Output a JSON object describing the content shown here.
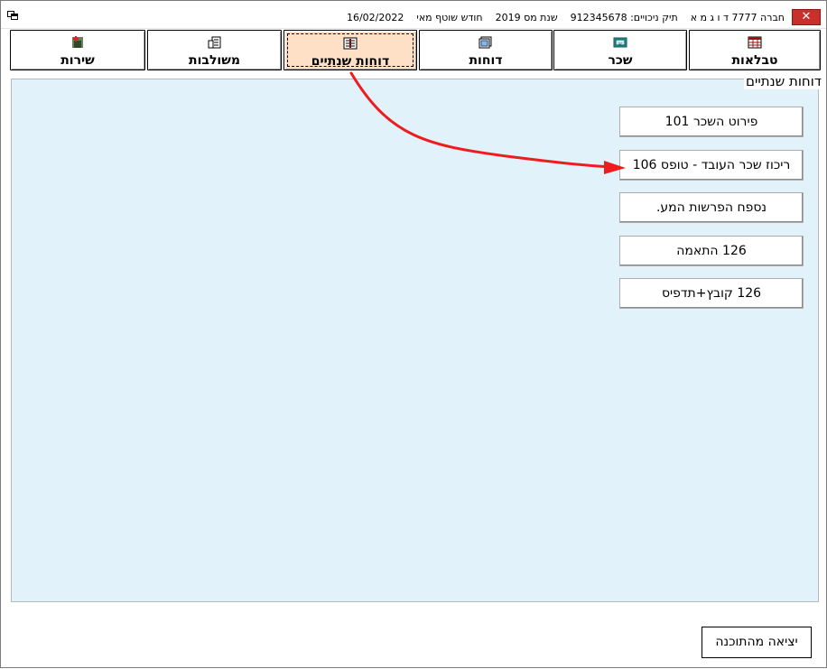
{
  "window": {
    "close_glyph": "✕",
    "title": {
      "company": "חברה 7777 ד ו ג מ א",
      "deduction_file": "תיק ניכויים: 912345678",
      "tax_year": "שנת מס 2019",
      "month": "חודש שוטף מאי",
      "date": "16/02/2022"
    }
  },
  "tabs": [
    {
      "label": "טבלאות",
      "icon": "table-icon"
    },
    {
      "label": "שכר",
      "icon": "wallet-icon"
    },
    {
      "label": "דוחות",
      "icon": "report-icon"
    },
    {
      "label": "דוחות שנתיים",
      "icon": "annual-report-icon",
      "active": true
    },
    {
      "label": "משולבות",
      "icon": "building-icon"
    },
    {
      "label": "שירות",
      "icon": "service-icon"
    }
  ],
  "panel": {
    "title": "דוחות שנתיים",
    "buttons": [
      {
        "label": "פירוט השכר 101"
      },
      {
        "label": "ריכוז שכר העובד - טופס 106"
      },
      {
        "label": "נספח הפרשות המע."
      },
      {
        "label": "126 התאמה"
      },
      {
        "label": "126 קובץ+תדפיס"
      }
    ]
  },
  "exit_button": {
    "label": "יציאה מהתוכנה"
  },
  "colors": {
    "panel_bg": "#e1f2fb",
    "active_tab_bg": "#fde0c5",
    "close_button": "#c9302c",
    "arrow": "#ee1c1c"
  }
}
